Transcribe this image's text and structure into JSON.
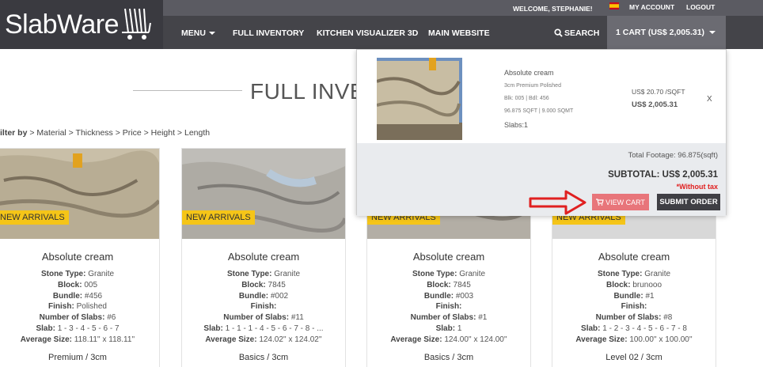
{
  "header": {
    "logo_text": "SlabWare",
    "welcome": "WELCOME, STEPHANIE!",
    "my_account": "MY ACCOUNT",
    "logout": "LOGOUT",
    "nav": {
      "menu": "MENU",
      "full_inventory": "FULL INVENTORY",
      "kitchen_visualizer": "KITCHEN VISUALIZER 3D",
      "main_website": "MAIN WEBSITE",
      "search": "SEARCH"
    },
    "cart_label": "1 CART (US$ 2,005.31)"
  },
  "page": {
    "title": "FULL INVENTORY",
    "filter_label": "ilter by",
    "filters": [
      " > Material",
      " > Thickness",
      " > Price",
      " > Height",
      " > Length"
    ]
  },
  "products": [
    {
      "badge": "NEW ARRIVALS",
      "name": "Absolute cream",
      "stone_type_label": "Stone Type:",
      "stone_type": "Granite",
      "block_label": "Block:",
      "block": "005",
      "bundle_label": "Bundle:",
      "bundle": "#456",
      "finish_label": "Finish:",
      "finish": "Polished",
      "num_slabs_label": "Number of Slabs:",
      "num_slabs": "#6",
      "slab_label": "Slab:",
      "slab": "1 - 3 - 4 - 5 - 6 - 7",
      "avg_size_label": "Average Size:",
      "avg_size": "118.11'' x 118.11''",
      "price_level": "Premium / 3cm"
    },
    {
      "badge": "NEW ARRIVALS",
      "name": "Absolute cream",
      "stone_type_label": "Stone Type:",
      "stone_type": "Granite",
      "block_label": "Block:",
      "block": "7845",
      "bundle_label": "Bundle:",
      "bundle": "#002",
      "finish_label": "Finish:",
      "finish": "",
      "num_slabs_label": "Number of Slabs:",
      "num_slabs": "#11",
      "slab_label": "Slab:",
      "slab": "1 - 1 - 1 - 4 - 5 - 6 - 7 - 8 - ...",
      "avg_size_label": "Average Size:",
      "avg_size": "124.02'' x 124.02''",
      "price_level": "Basics / 3cm"
    },
    {
      "badge": "NEW ARRIVALS",
      "name": "Absolute cream",
      "stone_type_label": "Stone Type:",
      "stone_type": "Granite",
      "block_label": "Block:",
      "block": "7845",
      "bundle_label": "Bundle:",
      "bundle": "#003",
      "finish_label": "Finish:",
      "finish": "",
      "num_slabs_label": "Number of Slabs:",
      "num_slabs": "#1",
      "slab_label": "Slab:",
      "slab": "1",
      "avg_size_label": "Average Size:",
      "avg_size": "124.00'' x 124.00''",
      "price_level": "Basics / 3cm"
    },
    {
      "badge": "NEW ARRIVALS",
      "name": "Absolute cream",
      "stone_type_label": "Stone Type:",
      "stone_type": "Granite",
      "block_label": "Block:",
      "block": "brunooo",
      "bundle_label": "Bundle:",
      "bundle": "#1",
      "finish_label": "Finish:",
      "finish": "",
      "num_slabs_label": "Number of Slabs:",
      "num_slabs": "#8",
      "slab_label": "Slab:",
      "slab": "1 - 2 - 3 - 4 - 5 - 6 - 7 - 8",
      "avg_size_label": "Average Size:",
      "avg_size": "100.00'' x 100.00''",
      "price_level": "Level 02 / 3cm"
    }
  ],
  "cart_dropdown": {
    "item_name": "Absolute cream",
    "item_finish": "3cm Premium Polished",
    "item_block": "Blk: 005 | Bdl: 456",
    "item_size": "96.875 SQFT | 9.000 SQMT",
    "item_slabs": "Slabs:1",
    "unit_price": "US$ 20.70 /SQFT",
    "line_total": "US$ 2,005.31",
    "remove": "X",
    "total_footage": "Total Footage: 96.875(sqft)",
    "subtotal": "SUBTOTAL: US$ 2,005.31",
    "tax_note": "*Without tax",
    "view_cart": "VIEW CART",
    "submit_order": "SUBMIT ORDER"
  },
  "colors": {
    "nav_bg": "#444449",
    "badge_yellow": "#f5c518",
    "view_cart_btn": "#e8757a",
    "arrow_red": "#e02020"
  }
}
